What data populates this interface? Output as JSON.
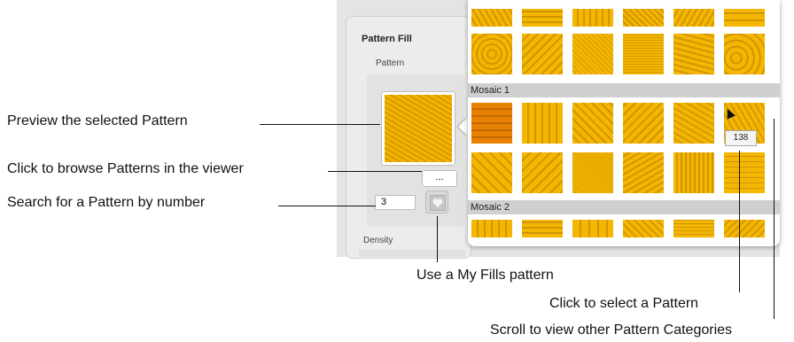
{
  "panel": {
    "title": "Pattern Fill",
    "pattern_label": "Pattern",
    "pattern_number": "3",
    "browse_label": "...",
    "density_label": "Density"
  },
  "viewer": {
    "categories": [
      "Mosaic 1",
      "Mosaic 2"
    ],
    "tooltip": "138"
  },
  "annotations": {
    "preview": "Preview the selected Pattern",
    "browse": "Click to browse Patterns in the viewer",
    "search": "Search for a Pattern by number",
    "myfills": "Use a My Fills pattern",
    "select": "Click to select a Pattern",
    "scroll": "Scroll to view other Pattern Categories"
  },
  "colors": {
    "tile": "#f2b400",
    "tile_dark": "#d49a00",
    "category_bar": "#cfcfcf"
  }
}
